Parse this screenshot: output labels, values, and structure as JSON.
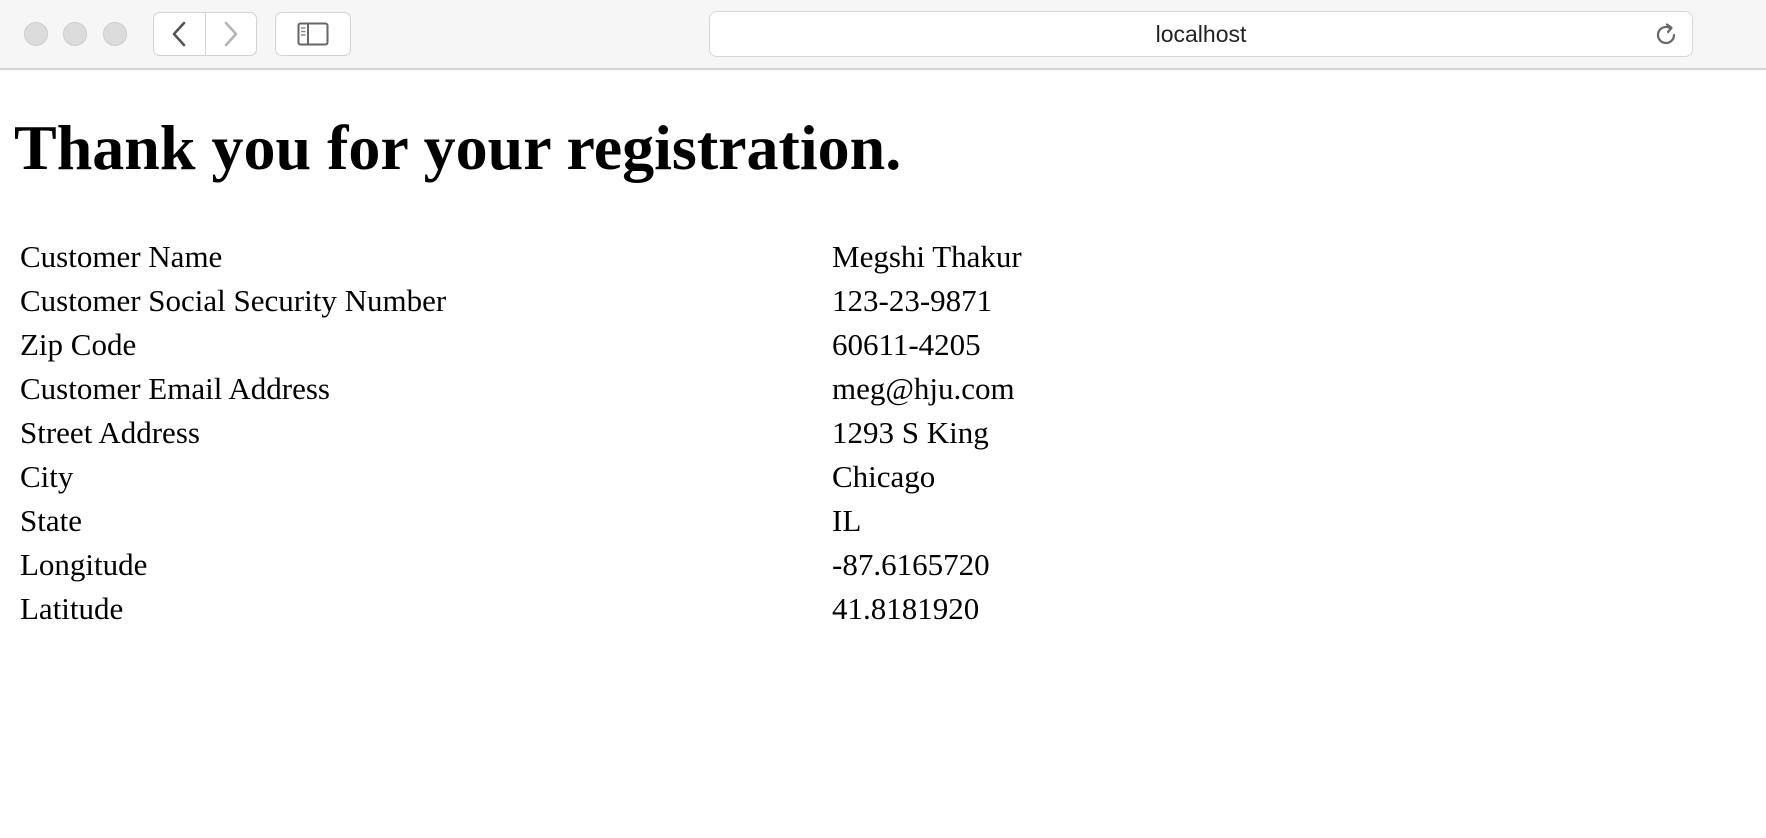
{
  "browser": {
    "address": "localhost"
  },
  "page": {
    "title": "Thank you for your registration.",
    "details": [
      {
        "label": "Customer Name",
        "value": "Megshi Thakur"
      },
      {
        "label": "Customer Social Security Number",
        "value": "123-23-9871"
      },
      {
        "label": "Zip Code",
        "value": "60611-4205"
      },
      {
        "label": "Customer Email Address",
        "value": "meg@hju.com"
      },
      {
        "label": "Street Address",
        "value": "1293 S King"
      },
      {
        "label": "City",
        "value": "Chicago"
      },
      {
        "label": "State",
        "value": "IL"
      },
      {
        "label": "Longitude",
        "value": "-87.6165720"
      },
      {
        "label": "Latitude",
        "value": "41.8181920"
      }
    ]
  }
}
